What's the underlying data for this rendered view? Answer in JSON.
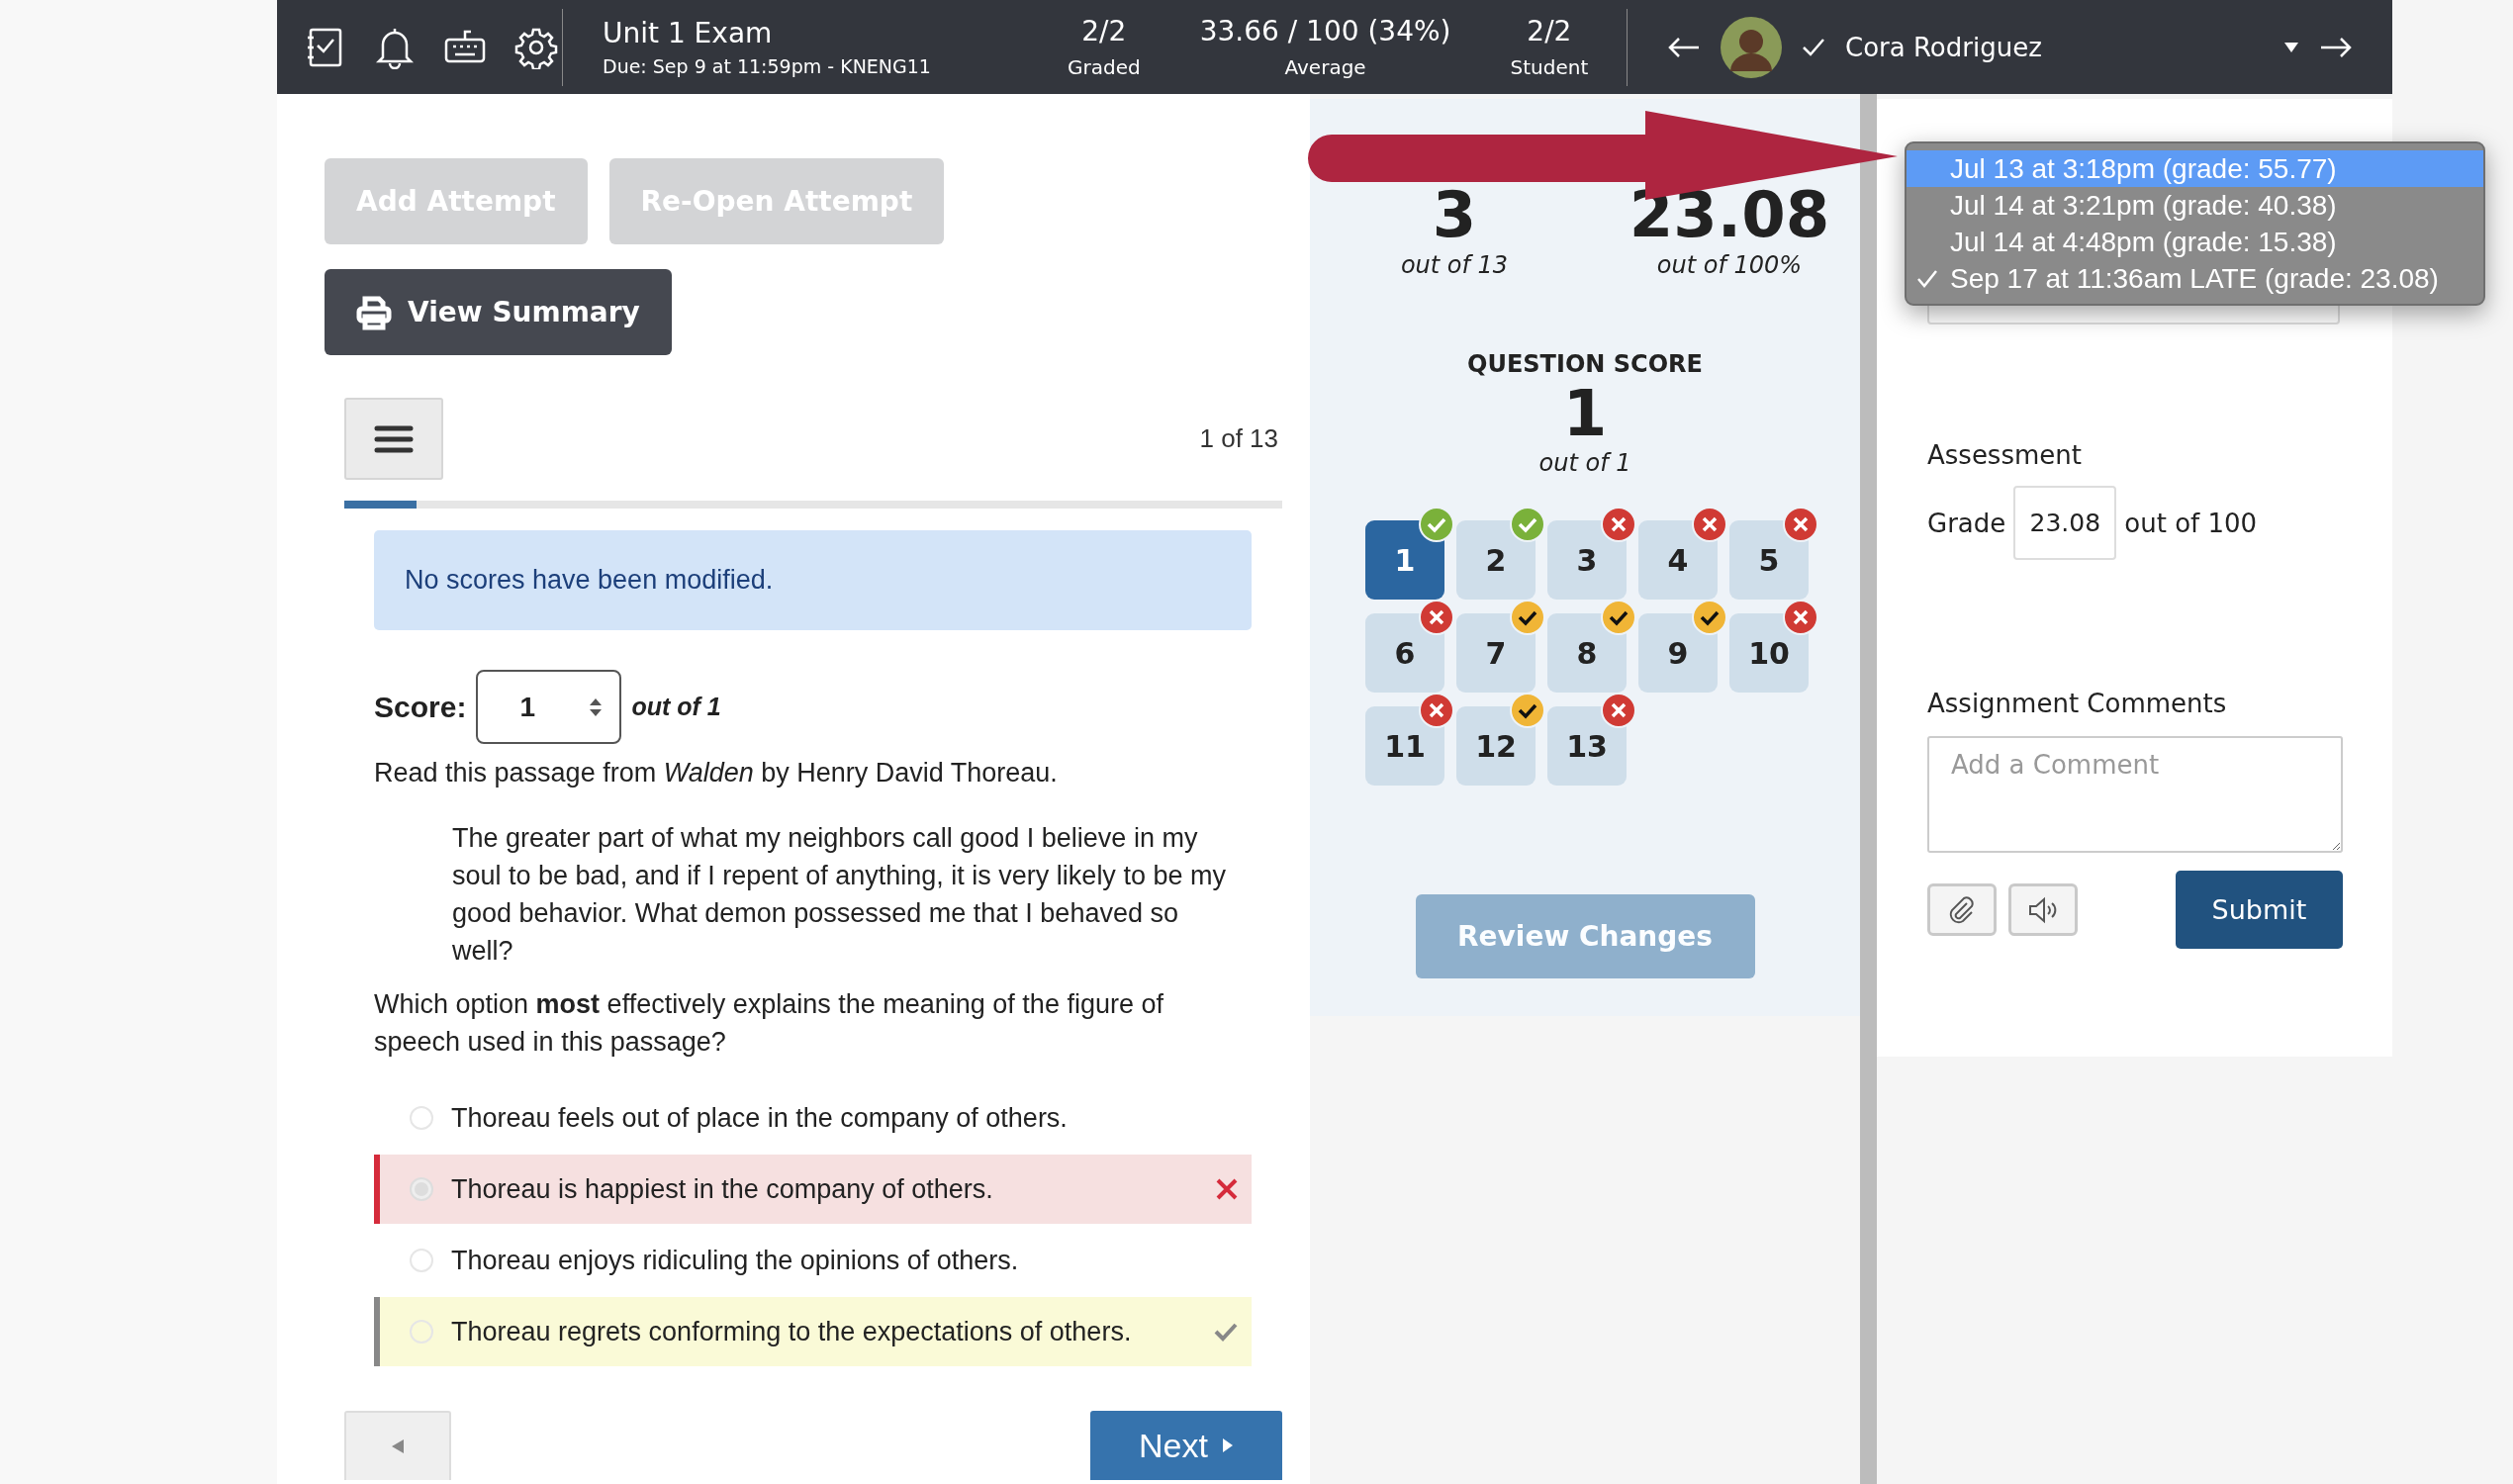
{
  "top_bar": {
    "assignment_title": "Unit 1 Exam",
    "due": "Due: Sep 9 at 11:59pm - KNENG11",
    "stats": [
      {
        "value": "2/2",
        "label": "Graded"
      },
      {
        "value": "33.66 / 100 (34%)",
        "label": "Average"
      },
      {
        "value": "2/2",
        "label": "Student"
      }
    ],
    "student": "Cora Rodriguez"
  },
  "actions": [
    {
      "label": "Add Attempt",
      "disabled": true
    },
    {
      "label": "Re-Open Attempt",
      "disabled": true
    }
  ],
  "view_summary": "View Summary",
  "question_nav": {
    "position": "1 of 13",
    "level": 0.077
  },
  "alert": "No scores have been modified.",
  "score": {
    "label": "Score:",
    "value": "1",
    "out_of": "out of 1"
  },
  "intro": "Read this passage from *Walden* by Henry David Thoreau.",
  "passage": "The greater part of what my neighbors call good I believe in my soul to be bad, and if I repent of anything, it is very likely to be my good behavior. What demon possessed me that I behaved so well?",
  "question": "Which option **most** effectively explains the meaning of the figure of speech used in this passage?",
  "options": [
    {
      "text": "Thoreau feels out of place in the company of others.",
      "selected": false,
      "kind": "plain"
    },
    {
      "text": "Thoreau is happiest in the company of others.",
      "selected": true,
      "kind": "incorrect"
    },
    {
      "text": "Thoreau enjoys ridiculing the opinions of others.",
      "selected": false,
      "kind": "plain"
    },
    {
      "text": "Thoreau regrets conforming to the expectations of others.",
      "selected": false,
      "kind": "correct"
    }
  ],
  "pager": {
    "next": "Next"
  },
  "summary": {
    "score": "3",
    "score_caption": "out of 13",
    "percent": "23.08",
    "percent_caption": "out of 100%",
    "question_score_title": "QUESTION SCORE",
    "question_score": "1",
    "question_score_caption": "out of 1"
  },
  "questions": [
    {
      "label": "1",
      "selected": true,
      "kind": "correct"
    },
    {
      "label": "2",
      "selected": false,
      "kind": "correct"
    },
    {
      "label": "3",
      "selected": false,
      "kind": "incorrect"
    },
    {
      "label": "4",
      "selected": false,
      "kind": "incorrect"
    },
    {
      "label": "5",
      "selected": false,
      "kind": "incorrect"
    },
    {
      "label": "6",
      "selected": false,
      "kind": "incorrect"
    },
    {
      "label": "7",
      "selected": false,
      "kind": "pending"
    },
    {
      "label": "8",
      "selected": false,
      "kind": "pending"
    },
    {
      "label": "9",
      "selected": false,
      "kind": "pending"
    },
    {
      "label": "10",
      "selected": false,
      "kind": "incorrect"
    },
    {
      "label": "11",
      "selected": false,
      "kind": "incorrect"
    },
    {
      "label": "12",
      "selected": false,
      "kind": "pending"
    },
    {
      "label": "13",
      "selected": false,
      "kind": "incorrect"
    }
  ],
  "review_changes": {
    "label": "Review Changes",
    "disabled": true
  },
  "attempts_menu": [
    {
      "label": "Jul 13 at 3:18pm (grade: 55.77)",
      "highlighted": true,
      "checked": false
    },
    {
      "label": "Jul 14 at 3:21pm (grade: 40.38)",
      "highlighted": false,
      "checked": false
    },
    {
      "label": "Jul 14 at 4:48pm (grade: 15.38)",
      "highlighted": false,
      "checked": false
    },
    {
      "label": "Sep 17 at 11:36am LATE (grade: 23.08)",
      "highlighted": false,
      "checked": true
    }
  ],
  "assessment": {
    "title": "Assessment",
    "grade_label": "Grade",
    "grade": "23.08",
    "out_of": "out of 100"
  },
  "comments": {
    "title": "Assignment Comments",
    "placeholder": "Add a Comment",
    "submit": "Submit"
  }
}
